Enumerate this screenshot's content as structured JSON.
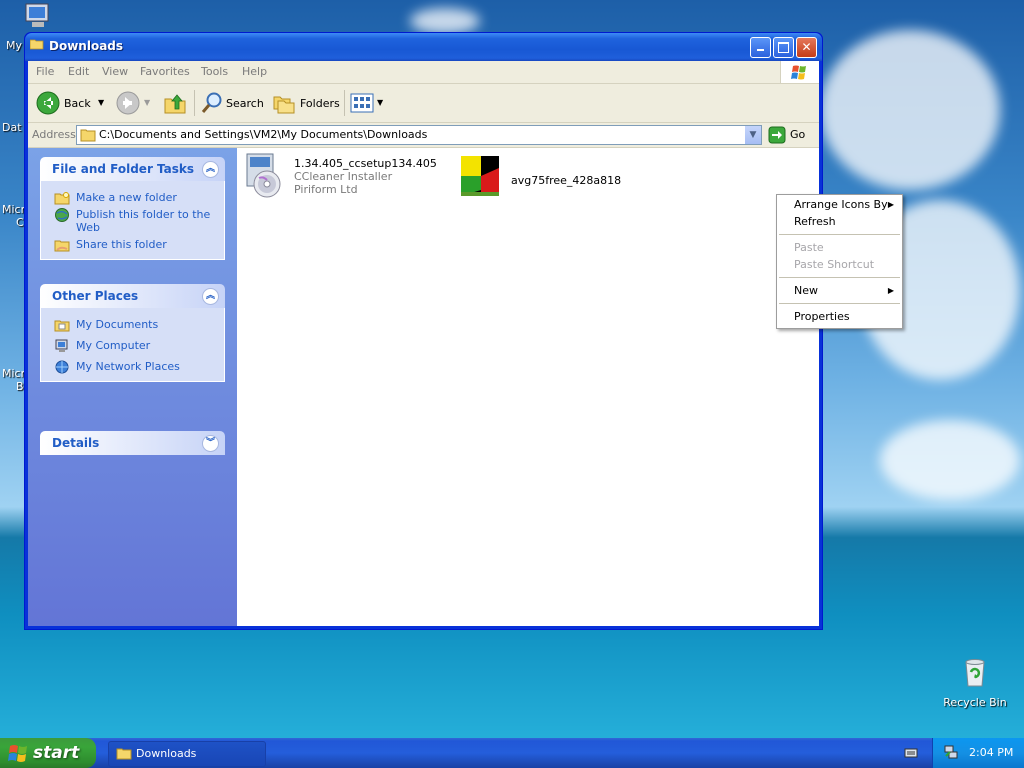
{
  "desktop": {
    "icons": [
      {
        "label": "My"
      },
      {
        "label": "Dat"
      },
      {
        "label": "Micro"
      },
      {
        "label": "C"
      },
      {
        "label": "Micro"
      },
      {
        "label": "B"
      }
    ],
    "recycle_bin": "Recycle Bin"
  },
  "window": {
    "title": "Downloads",
    "menu": [
      "File",
      "Edit",
      "View",
      "Favorites",
      "Tools",
      "Help"
    ],
    "toolbar": {
      "back": "Back",
      "search": "Search",
      "folders": "Folders"
    },
    "address": {
      "label": "Address",
      "value": "C:\\Documents and Settings\\VM2\\My Documents\\Downloads",
      "go": "Go"
    }
  },
  "left_pane": {
    "file_tasks": {
      "title": "File and Folder Tasks",
      "items": [
        "Make a new folder",
        "Publish this folder to the Web",
        "Share this folder"
      ]
    },
    "other_places": {
      "title": "Other Places",
      "items": [
        "My Documents",
        "My Computer",
        "My Network Places"
      ]
    },
    "details": {
      "title": "Details"
    }
  },
  "files": [
    {
      "name": "1.34.405_ccsetup134.405",
      "line2": "CCleaner Installer",
      "line3": "Piriform Ltd"
    },
    {
      "name": "avg75free_428a818"
    }
  ],
  "context_menu": {
    "arrange": "Arrange Icons By",
    "refresh": "Refresh",
    "paste": "Paste",
    "paste_shortcut": "Paste Shortcut",
    "new": "New",
    "properties": "Properties"
  },
  "taskbar": {
    "start": "start",
    "task": "Downloads",
    "clock": "2:04 PM"
  },
  "colors": {
    "titlebar": "#1858d4",
    "link": "#215dc6",
    "start_green": "#39a53a"
  }
}
